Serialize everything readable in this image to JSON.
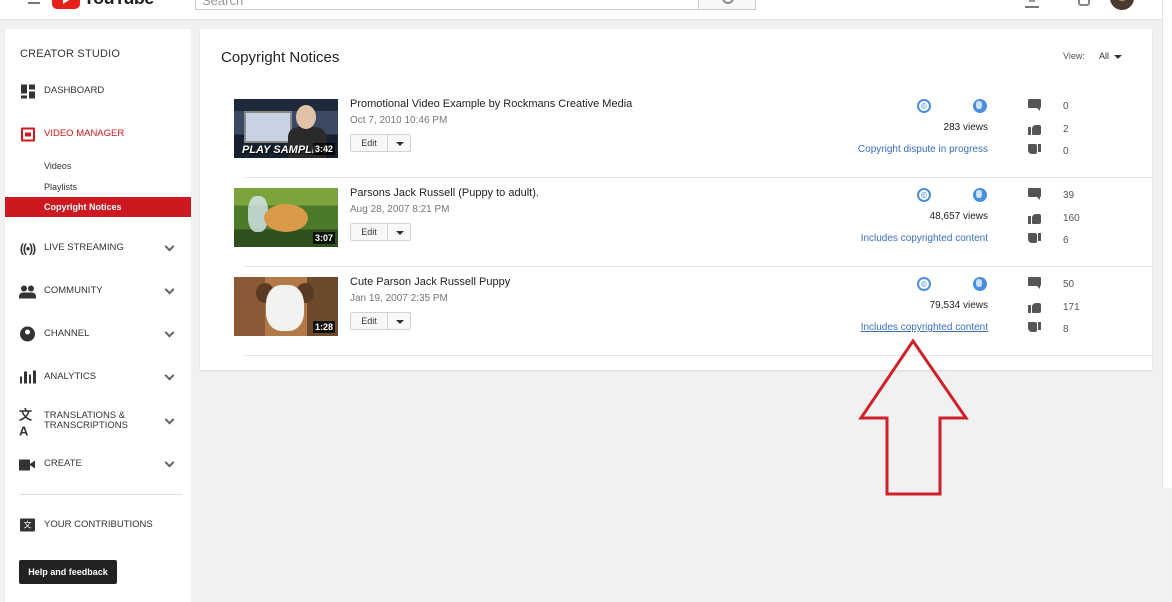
{
  "topbar": {
    "logo_text": "YouTube",
    "search_placeholder": "Search"
  },
  "sidebar": {
    "title": "CREATOR STUDIO",
    "items": [
      {
        "label": "DASHBOARD",
        "icon": "dashboard-icon"
      },
      {
        "label": "VIDEO MANAGER",
        "icon": "video-manager-icon",
        "active": true
      },
      {
        "label": "LIVE STREAMING",
        "icon": "live-streaming-icon"
      },
      {
        "label": "COMMUNITY",
        "icon": "community-icon"
      },
      {
        "label": "CHANNEL",
        "icon": "channel-icon"
      },
      {
        "label": "ANALYTICS",
        "icon": "analytics-icon"
      },
      {
        "label": "TRANSLATIONS & TRANSCRIPTIONS",
        "label_line1": "TRANSLATIONS &",
        "label_line2": "TRANSCRIPTIONS",
        "icon": "translate-icon"
      },
      {
        "label": "CREATE",
        "icon": "create-icon"
      }
    ],
    "subitems": [
      "Videos",
      "Playlists",
      "Copyright Notices"
    ],
    "contributions": "YOUR CONTRIBUTIONS",
    "help_button": "Help and feedback"
  },
  "main": {
    "title": "Copyright Notices",
    "view_label": "View:",
    "view_value": "All",
    "edit_label": "Edit",
    "videos": [
      {
        "title": "Promotional Video Example by Rockmans Creative Media",
        "date": "Oct 7, 2010 10:46 PM",
        "duration": "3:42",
        "thumb_overlay": "PLAY SAMPLE V",
        "views": "283 views",
        "status": "Copyright dispute in progress",
        "comments": "0",
        "likes": "2",
        "dislikes": "0"
      },
      {
        "title": "Parsons Jack Russell (Puppy to adult).",
        "date": "Aug 28, 2007 8:21 PM",
        "duration": "3:07",
        "views": "48,657 views",
        "status": "Includes copyrighted content",
        "comments": "39",
        "likes": "160",
        "dislikes": "6"
      },
      {
        "title": "Cute Parson Jack Russell Puppy",
        "date": "Jan 19, 2007 2:35 PM",
        "duration": "1:28",
        "views": "79,534 views",
        "status": "Includes copyrighted content",
        "comments": "50",
        "likes": "171",
        "dislikes": "8"
      }
    ]
  },
  "colors": {
    "accent_red": "#cc181e",
    "link_blue": "#3a6ebd",
    "annotation_arrow": "#d0202a"
  }
}
